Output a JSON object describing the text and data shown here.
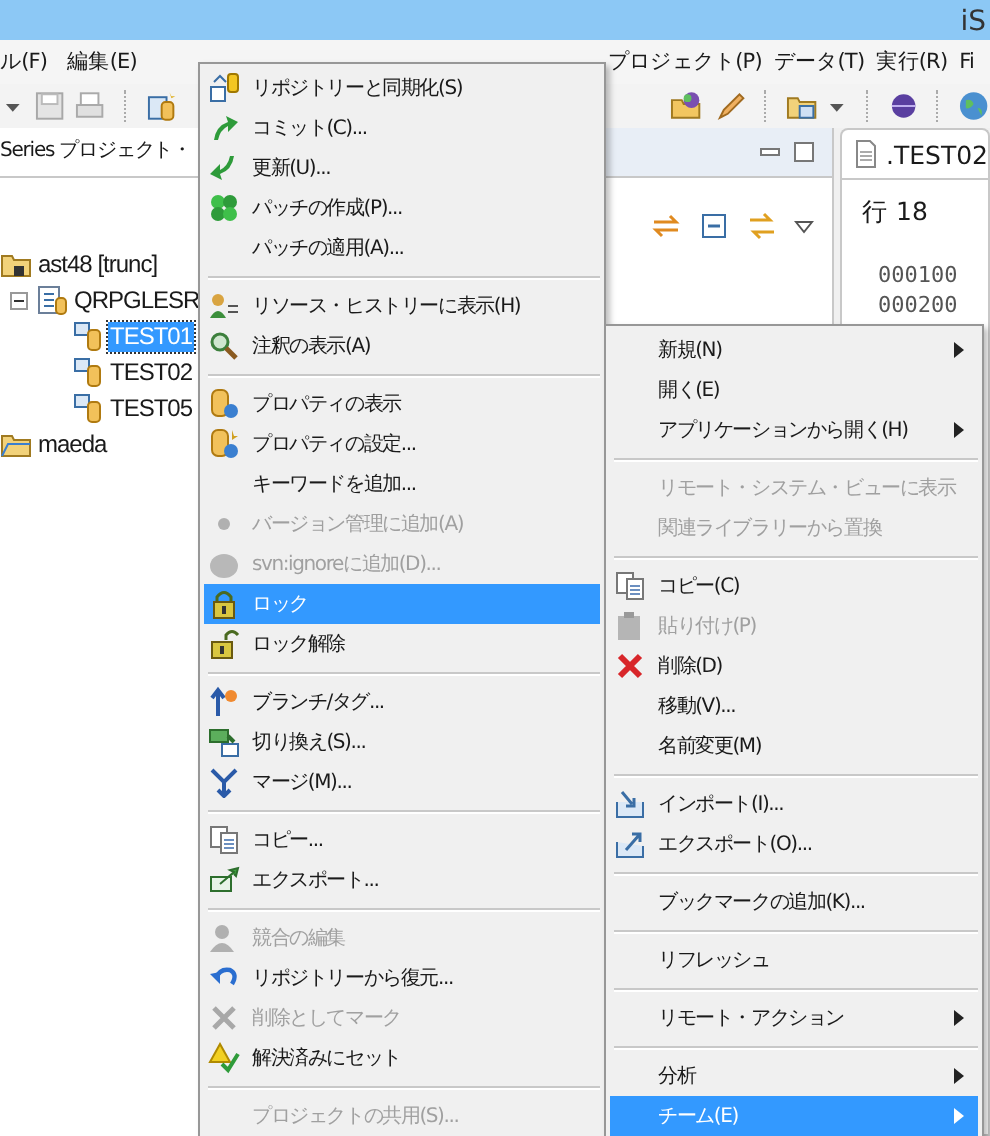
{
  "window": {
    "title": "iS"
  },
  "menubar": [
    {
      "label": "ル(F)"
    },
    {
      "label": "編集(E)"
    },
    {
      "label": "プロジェクト(P)"
    },
    {
      "label": "データ(T)"
    },
    {
      "label": "実行(R)"
    },
    {
      "label": "Fi"
    }
  ],
  "left_panel": {
    "tab": "Series プロジェクト・",
    "tree": [
      {
        "label": "ast48 [trunc]",
        "selected": false,
        "children": [
          {
            "label": "QRPGLESR",
            "expanded": true,
            "selected": false,
            "children": [
              {
                "label": "TEST01",
                "selected": true
              },
              {
                "label": "TEST02",
                "selected": false
              },
              {
                "label": "TEST05",
                "selected": false
              }
            ]
          }
        ]
      },
      {
        "label": "maeda",
        "selected": false
      }
    ]
  },
  "editor": {
    "tab": ".TEST02",
    "line_label": "行 18",
    "lines": [
      "000100",
      "000200"
    ]
  },
  "team_submenu": {
    "items": [
      {
        "kind": "item",
        "label": "リポジトリーと同期化(S)",
        "disabled": false,
        "selected": false
      },
      {
        "kind": "item",
        "label": "コミット(C)...",
        "disabled": false,
        "selected": false
      },
      {
        "kind": "item",
        "label": "更新(U)...",
        "disabled": false,
        "selected": false
      },
      {
        "kind": "item",
        "label": "パッチの作成(P)...",
        "disabled": false,
        "selected": false
      },
      {
        "kind": "item",
        "label": "パッチの適用(A)...",
        "disabled": false,
        "selected": false
      },
      {
        "kind": "separator"
      },
      {
        "kind": "item",
        "label": "リソース・ヒストリーに表示(H)",
        "disabled": false,
        "selected": false
      },
      {
        "kind": "item",
        "label": "注釈の表示(A)",
        "disabled": false,
        "selected": false
      },
      {
        "kind": "separator"
      },
      {
        "kind": "item",
        "label": "プロパティの表示",
        "disabled": false,
        "selected": false
      },
      {
        "kind": "item",
        "label": "プロパティの設定...",
        "disabled": false,
        "selected": false
      },
      {
        "kind": "item",
        "label": "キーワードを追加...",
        "disabled": false,
        "selected": false
      },
      {
        "kind": "item",
        "label": "バージョン管理に追加(A)",
        "disabled": true,
        "selected": false
      },
      {
        "kind": "item",
        "label": "svn:ignoreに追加(D)...",
        "disabled": true,
        "selected": false
      },
      {
        "kind": "item",
        "label": "ロック",
        "disabled": false,
        "selected": true
      },
      {
        "kind": "item",
        "label": "ロック解除",
        "disabled": false,
        "selected": false
      },
      {
        "kind": "separator"
      },
      {
        "kind": "item",
        "label": "ブランチ/タグ...",
        "disabled": false,
        "selected": false
      },
      {
        "kind": "item",
        "label": "切り換え(S)...",
        "disabled": false,
        "selected": false
      },
      {
        "kind": "item",
        "label": "マージ(M)...",
        "disabled": false,
        "selected": false
      },
      {
        "kind": "separator"
      },
      {
        "kind": "item",
        "label": "コピー...",
        "disabled": false,
        "selected": false
      },
      {
        "kind": "item",
        "label": "エクスポート...",
        "disabled": false,
        "selected": false
      },
      {
        "kind": "separator"
      },
      {
        "kind": "item",
        "label": "競合の編集",
        "disabled": true,
        "selected": false
      },
      {
        "kind": "item",
        "label": "リポジトリーから復元...",
        "disabled": false,
        "selected": false
      },
      {
        "kind": "item",
        "label": "削除としてマーク",
        "disabled": true,
        "selected": false
      },
      {
        "kind": "item",
        "label": "解決済みにセット",
        "disabled": false,
        "selected": false
      },
      {
        "kind": "separator"
      },
      {
        "kind": "item",
        "label": "プロジェクトの共用(S)...",
        "disabled": true,
        "selected": false
      }
    ]
  },
  "context_menu": {
    "items": [
      {
        "kind": "item",
        "label": "新規(N)",
        "disabled": false,
        "selected": false,
        "submenu": true
      },
      {
        "kind": "item",
        "label": "開く(E)",
        "disabled": false,
        "selected": false,
        "submenu": false
      },
      {
        "kind": "item",
        "label": "アプリケーションから開く(H)",
        "disabled": false,
        "selected": false,
        "submenu": true
      },
      {
        "kind": "separator"
      },
      {
        "kind": "item",
        "label": "リモート・システム・ビューに表示",
        "disabled": true,
        "selected": false,
        "submenu": false
      },
      {
        "kind": "item",
        "label": "関連ライブラリーから置換",
        "disabled": true,
        "selected": false,
        "submenu": false
      },
      {
        "kind": "separator"
      },
      {
        "kind": "item",
        "label": "コピー(C)",
        "disabled": false,
        "selected": false,
        "submenu": false
      },
      {
        "kind": "item",
        "label": "貼り付け(P)",
        "disabled": true,
        "selected": false,
        "submenu": false
      },
      {
        "kind": "item",
        "label": "削除(D)",
        "disabled": false,
        "selected": false,
        "submenu": false
      },
      {
        "kind": "item",
        "label": "移動(V)...",
        "disabled": false,
        "selected": false,
        "submenu": false
      },
      {
        "kind": "item",
        "label": "名前変更(M)",
        "disabled": false,
        "selected": false,
        "submenu": false
      },
      {
        "kind": "separator"
      },
      {
        "kind": "item",
        "label": "インポート(I)...",
        "disabled": false,
        "selected": false,
        "submenu": false
      },
      {
        "kind": "item",
        "label": "エクスポート(O)...",
        "disabled": false,
        "selected": false,
        "submenu": false
      },
      {
        "kind": "separator"
      },
      {
        "kind": "item",
        "label": "ブックマークの追加(K)...",
        "disabled": false,
        "selected": false,
        "submenu": false
      },
      {
        "kind": "separator"
      },
      {
        "kind": "item",
        "label": "リフレッシュ",
        "disabled": false,
        "selected": false,
        "submenu": false
      },
      {
        "kind": "separator"
      },
      {
        "kind": "item",
        "label": "リモート・アクション",
        "disabled": false,
        "selected": false,
        "submenu": true
      },
      {
        "kind": "separator"
      },
      {
        "kind": "item",
        "label": "分析",
        "disabled": false,
        "selected": false,
        "submenu": true
      },
      {
        "kind": "item",
        "label": "チーム(E)",
        "disabled": false,
        "selected": true,
        "submenu": true
      }
    ]
  }
}
